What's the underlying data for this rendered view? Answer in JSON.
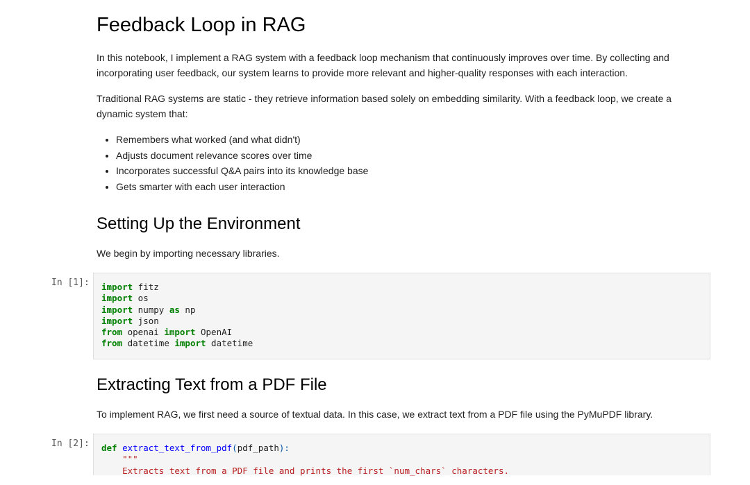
{
  "heading": "Feedback Loop in RAG",
  "intro_paragraph": "In this notebook, I implement a RAG system with a feedback loop mechanism that continuously improves over time. By collecting and incorporating user feedback, our system learns to provide more relevant and higher-quality responses with each interaction.",
  "static_paragraph": "Traditional RAG systems are static - they retrieve information based solely on embedding similarity. With a feedback loop, we create a dynamic system that:",
  "bullets": [
    "Remembers what worked (and what didn't)",
    "Adjusts document relevance scores over time",
    "Incorporates successful Q&A pairs into its knowledge base",
    "Gets smarter with each user interaction"
  ],
  "section1": {
    "title": "Setting Up the Environment",
    "text": "We begin by importing necessary libraries."
  },
  "cell1": {
    "prompt": "In [1]:",
    "lines": [
      {
        "kw1": "import",
        "rest1": " fitz"
      },
      {
        "kw1": "import",
        "rest1": " os"
      },
      {
        "kw1": "import",
        "rest1": " numpy ",
        "kw2": "as",
        "rest2": " np"
      },
      {
        "kw1": "import",
        "rest1": " json"
      },
      {
        "kw1": "from",
        "rest1": " openai ",
        "kw2": "import",
        "rest2": " OpenAI"
      },
      {
        "kw1": "from",
        "rest1": " datetime ",
        "kw2": "import",
        "rest2": " datetime"
      }
    ]
  },
  "section2": {
    "title": "Extracting Text from a PDF File",
    "text": "To implement RAG, we first need a source of textual data. In this case, we extract text from a PDF file using the PyMuPDF library."
  },
  "cell2": {
    "prompt": "In [2]:",
    "def_kw": "def",
    "func_name": " extract_text_from_pdf",
    "open_paren": "(",
    "param": "pdf_path",
    "close_paren": "):",
    "docstring_open": "    \"\"\"",
    "docstring_line": "    Extracts text from a PDF file and prints the first `num_chars` characters."
  }
}
